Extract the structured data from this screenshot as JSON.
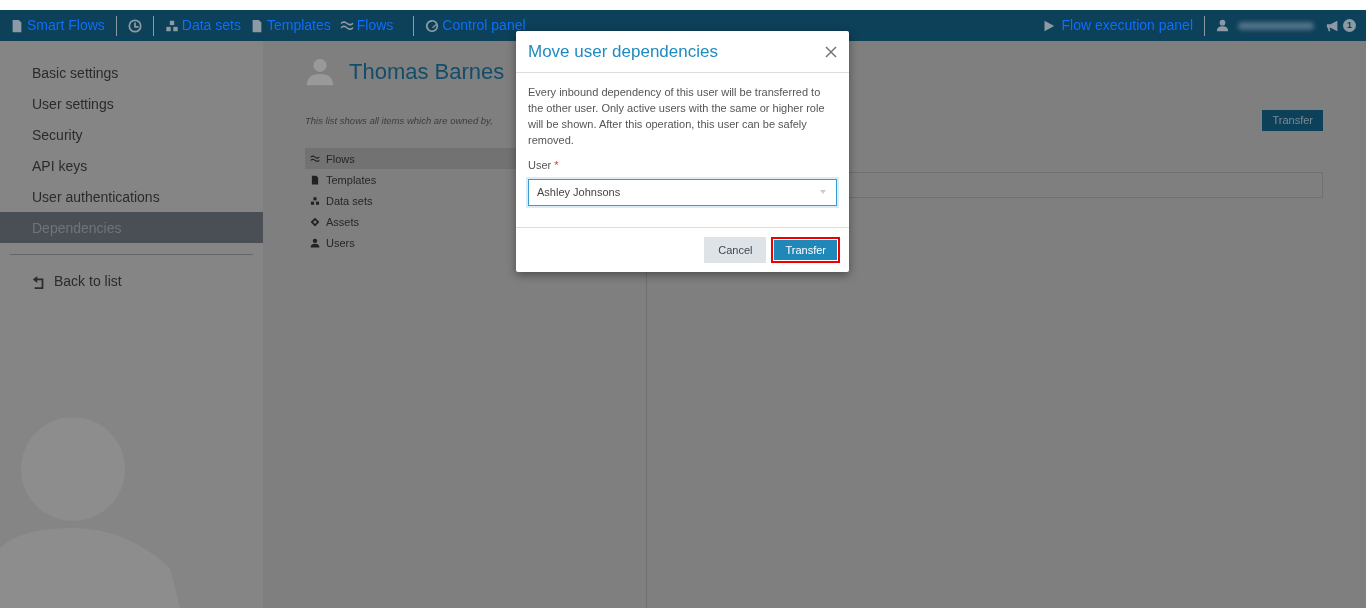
{
  "navbar": {
    "brand": "Smart Flows",
    "left_items": [
      {
        "kind": "history"
      },
      {
        "kind": "datasets",
        "label": "Data sets"
      },
      {
        "kind": "templates",
        "label": "Templates"
      },
      {
        "kind": "flows",
        "label": "Flows"
      },
      {
        "kind": "control",
        "label": "Control panel"
      }
    ],
    "execution_link": "Flow execution panel",
    "notification_count": "1"
  },
  "sidebar": {
    "items": [
      {
        "label": "Basic settings",
        "selected": false
      },
      {
        "label": "User settings",
        "selected": false
      },
      {
        "label": "Security",
        "selected": false
      },
      {
        "label": "API keys",
        "selected": false
      },
      {
        "label": "User authentications",
        "selected": false
      },
      {
        "label": "Dependencies",
        "selected": true
      }
    ],
    "back_link": "Back to list"
  },
  "main": {
    "title": "Thomas Barnes",
    "description": "This list shows all items which are owned by,",
    "categories": [
      {
        "kind": "flows",
        "label": "Flows",
        "selected": true
      },
      {
        "kind": "templates",
        "label": "Templates",
        "selected": false
      },
      {
        "kind": "datasets",
        "label": "Data sets",
        "selected": false
      },
      {
        "kind": "assets",
        "label": "Assets",
        "selected": false
      },
      {
        "kind": "users",
        "label": "Users",
        "selected": false
      }
    ],
    "transfer_button": "Transfer"
  },
  "modal": {
    "title": "Move user dependencies",
    "text": "Every inbound dependency of this user will be transferred to the other user. Only active users with the same or higher role will be shown. After this operation, this user can be safely removed.",
    "field_label": "User",
    "required_mark": "*",
    "field_value": "Ashley Johnsons",
    "buttons": [
      {
        "kind": "secondary",
        "label": "Cancel",
        "highlighted": false
      },
      {
        "kind": "primary",
        "label": "Transfer",
        "highlighted": true
      }
    ]
  }
}
